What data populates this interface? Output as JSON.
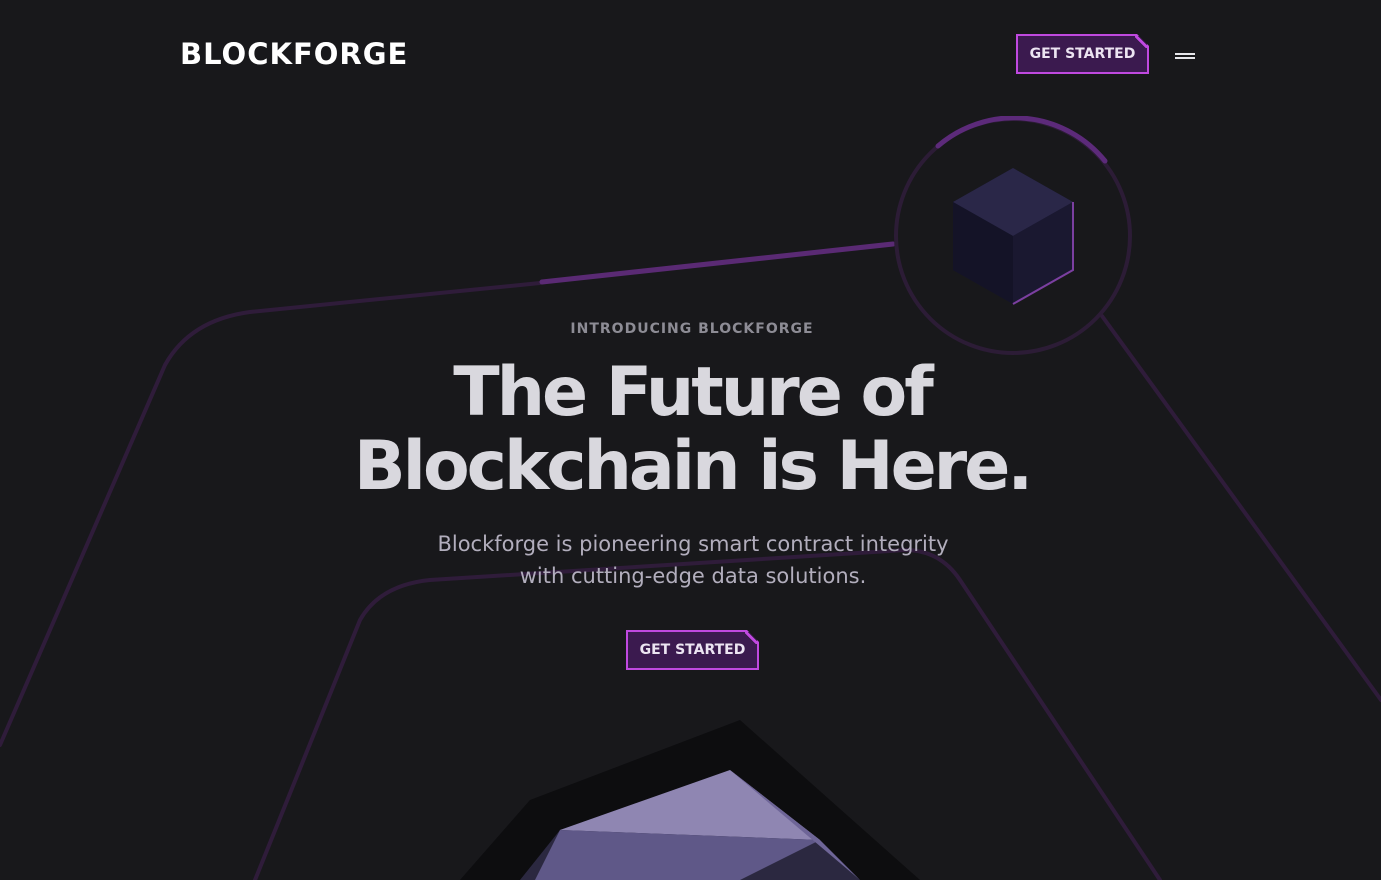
{
  "brand": {
    "logo_text": "BLOCKFORGE"
  },
  "header": {
    "cta_label": "GET STARTED",
    "menu_icon": "hamburger-menu-icon"
  },
  "hero": {
    "eyebrow": "INTRODUCING BLOCKFORGE",
    "headline_line1": "The Future of",
    "headline_line2": "Blockchain is Here.",
    "subtext_line1": "Blockforge is pioneering smart contract integrity",
    "subtext_line2": "with cutting-edge data solutions.",
    "cta_label": "GET STARTED"
  },
  "decor": {
    "top_cube_icon": "cube-icon",
    "bottom_gem_icon": "crystal-icon"
  },
  "colors": {
    "background": "#18181b",
    "accent": "#c049e0",
    "button_fill": "#3b1a4f",
    "line_color": "#3a1e48",
    "line_highlight": "#6b2a8a",
    "headline": "#d9d8de",
    "muted": "#8d8c95"
  }
}
